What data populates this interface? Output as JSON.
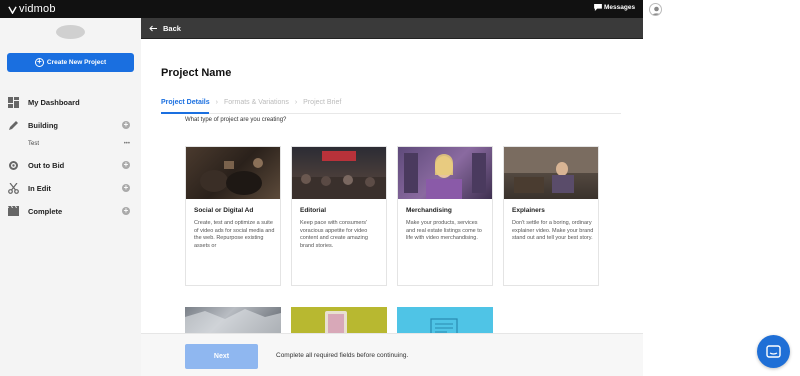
{
  "app": {
    "logo_text": "vidmob",
    "messages_label": "Messages"
  },
  "sidebar": {
    "create_label": "Create New Project",
    "items": [
      {
        "label": "My Dashboard",
        "icon": "dashboard-icon"
      },
      {
        "label": "Building",
        "icon": "pencil-icon"
      },
      {
        "label": "Out to Bid",
        "icon": "gear-icon"
      },
      {
        "label": "In Edit",
        "icon": "scissors-icon"
      },
      {
        "label": "Complete",
        "icon": "film-icon"
      }
    ],
    "sub_item": {
      "label": "Test",
      "more": "•••"
    }
  },
  "backbar": {
    "label": "Back"
  },
  "main": {
    "project_name": "Project Name",
    "steps": [
      "Project Details",
      "Formats & Variations",
      "Project Brief"
    ],
    "question": "What type of project are you creating?",
    "cards": [
      {
        "title": "Social or Digital Ad",
        "desc": "Create, test and optimize a suite of video ads for social media and the web. Repurpose existing assets or"
      },
      {
        "title": "Editorial",
        "desc": "Keep pace with consumers' voracious appetite for video content and create amazing brand stories."
      },
      {
        "title": "Merchandising",
        "desc": "Make your products, services and real estate listings come to life with video merchandising."
      },
      {
        "title": "Explainers",
        "desc": "Don't settle for a boring, ordinary explainer video. Make your brand stand out and tell your best story."
      }
    ]
  },
  "footer": {
    "next_label": "Next",
    "message": "Complete all required fields before continuing."
  },
  "colors": {
    "accent": "#1a6fe0",
    "topbar": "#111111",
    "backbar": "#3a3a3a"
  }
}
